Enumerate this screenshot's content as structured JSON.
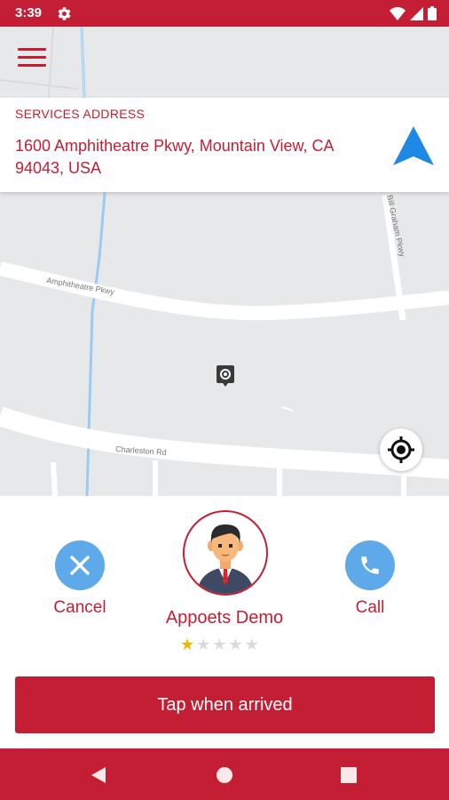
{
  "status_bar": {
    "time": "3:39",
    "icons": [
      "gear-icon",
      "wifi-icon",
      "signal-icon",
      "battery-icon"
    ]
  },
  "map": {
    "road_labels": [
      "Amphitheatre Pkwy",
      "Charleston Rd",
      "Bill Graham Pkwy"
    ]
  },
  "address_card": {
    "label": "SERVICES ADDRESS",
    "address": "1600 Amphitheatre Pkwy, Mountain View, CA 94043, USA"
  },
  "actions": {
    "cancel_label": "Cancel",
    "call_label": "Call"
  },
  "driver": {
    "name": "Appoets Demo",
    "rating": 1,
    "max_rating": 5,
    "stars": [
      "★",
      "★",
      "★",
      "★",
      "★"
    ]
  },
  "primary_button": {
    "label": "Tap when arrived"
  },
  "colors": {
    "brand": "#c41e35",
    "action_blue": "#5ea9e9",
    "nav_arrow_blue": "#1e88e5",
    "star_filled": "#f5b400",
    "star_empty": "#d9d9d9"
  }
}
